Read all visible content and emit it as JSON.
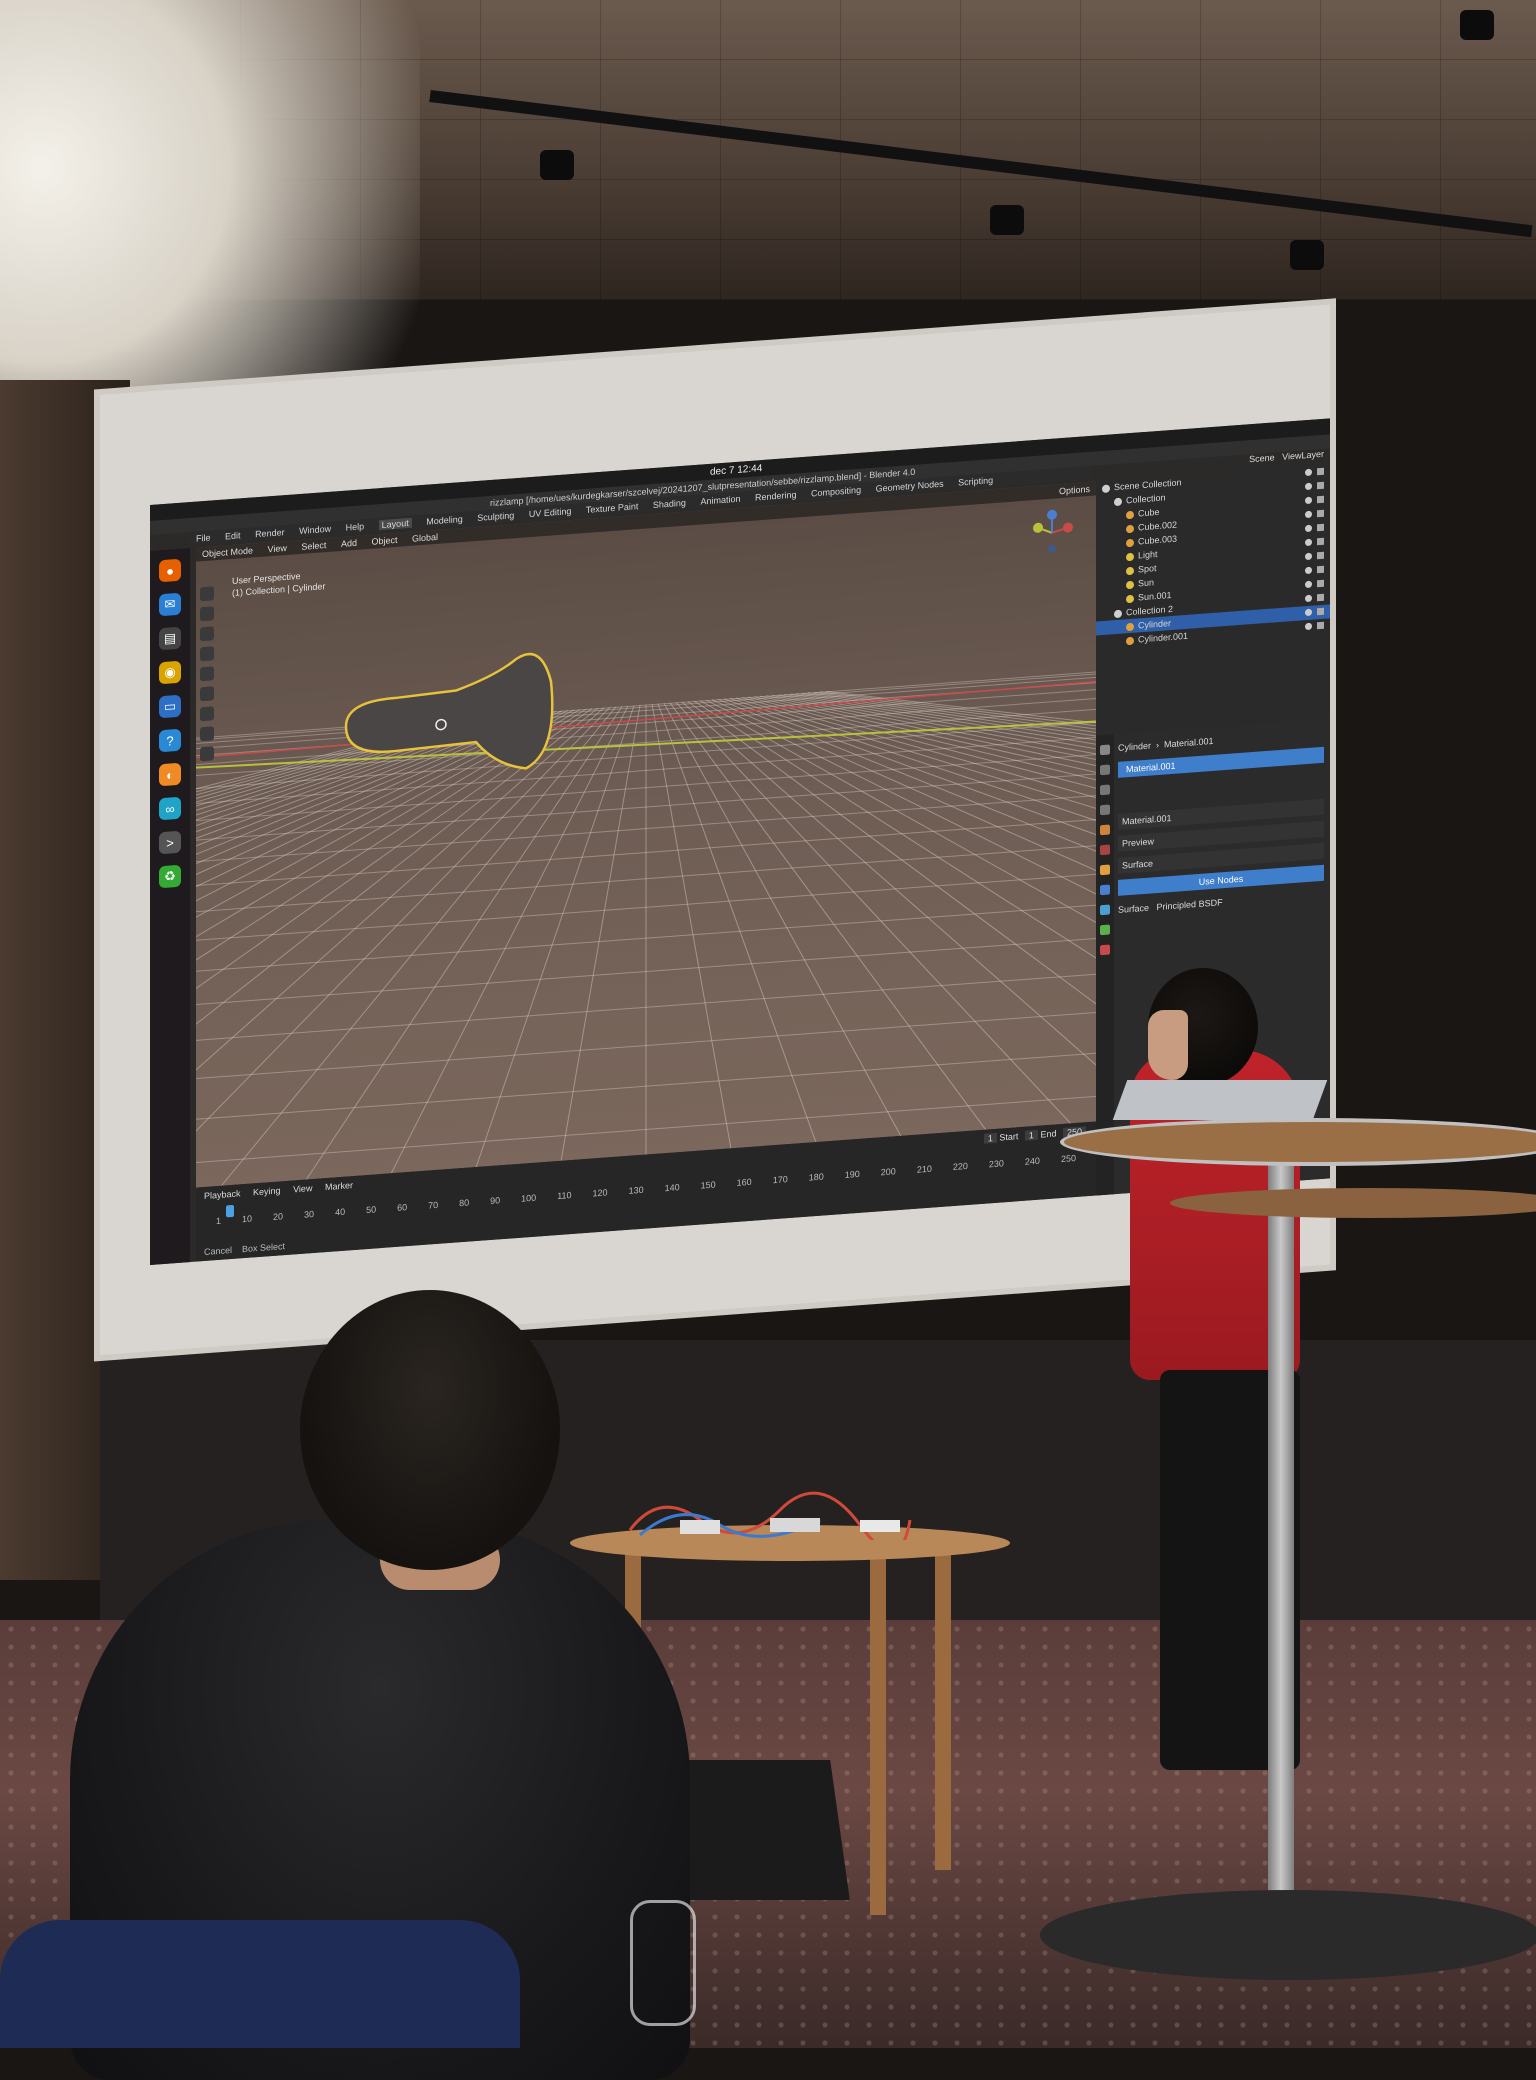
{
  "blender": {
    "clock": "dec 7 12:44",
    "window_title": "rizzlamp [/home/ues/kurdegkarser/szcelvej/20241207_slutpresentation/sebbe/rizzlamp.blend] - Blender 4.0",
    "menu": [
      "File",
      "Edit",
      "Render",
      "Window",
      "Help"
    ],
    "workspaces": [
      "Layout",
      "Modeling",
      "Sculpting",
      "UV Editing",
      "Texture Paint",
      "Shading",
      "Animation",
      "Rendering",
      "Compositing",
      "Geometry Nodes",
      "Scripting"
    ],
    "active_workspace": "Layout",
    "scene_label": "Scene",
    "view_layer_label": "ViewLayer",
    "viewport": {
      "header": [
        "Object Mode",
        "View",
        "Select",
        "Add",
        "Object"
      ],
      "transform": "Global",
      "info_line1": "User Perspective",
      "info_line2": "(1) Collection | Cylinder",
      "options": "Options"
    },
    "timeline": {
      "menus": [
        "Playback",
        "Keying",
        "View",
        "Marker"
      ],
      "current_frame": "1",
      "start_label": "Start",
      "start": "1",
      "end_label": "End",
      "end": "250",
      "frames": [
        "1",
        "10",
        "20",
        "30",
        "40",
        "50",
        "60",
        "70",
        "80",
        "90",
        "100",
        "110",
        "120",
        "130",
        "140",
        "150",
        "160",
        "170",
        "180",
        "190",
        "200",
        "210",
        "220",
        "230",
        "240",
        "250"
      ],
      "status": [
        "Cancel",
        "Box Select"
      ]
    },
    "outliner": {
      "rows": [
        {
          "label": "Scene Collection",
          "indent": 0,
          "selected": false,
          "color": "#cfcfcf"
        },
        {
          "label": "Collection",
          "indent": 1,
          "selected": false,
          "color": "#cfcfcf"
        },
        {
          "label": "Cube",
          "indent": 2,
          "selected": false,
          "color": "#e0a040"
        },
        {
          "label": "Cube.002",
          "indent": 2,
          "selected": false,
          "color": "#e0a040"
        },
        {
          "label": "Cube.003",
          "indent": 2,
          "selected": false,
          "color": "#e0a040"
        },
        {
          "label": "Light",
          "indent": 2,
          "selected": false,
          "color": "#e0c040"
        },
        {
          "label": "Spot",
          "indent": 2,
          "selected": false,
          "color": "#e0c040"
        },
        {
          "label": "Sun",
          "indent": 2,
          "selected": false,
          "color": "#e0c040"
        },
        {
          "label": "Sun.001",
          "indent": 2,
          "selected": false,
          "color": "#e0c040"
        },
        {
          "label": "Collection 2",
          "indent": 1,
          "selected": false,
          "color": "#cfcfcf"
        },
        {
          "label": "Cylinder",
          "indent": 2,
          "selected": true,
          "color": "#e0a040"
        },
        {
          "label": "Cylinder.001",
          "indent": 2,
          "selected": false,
          "color": "#e0a040"
        }
      ]
    },
    "properties": {
      "breadcrumb_object": "Cylinder",
      "breadcrumb_material": "Material.001",
      "material_slot": "Material.001",
      "material_field": "Material.001",
      "preview_label": "Preview",
      "surface_label": "Surface",
      "use_nodes_button": "Use Nodes",
      "surface_field_label": "Surface",
      "surface_shader": "Principled BSDF"
    },
    "colors": {
      "viewport_top": "#5a4c44",
      "selection_outline": "#e8c23a",
      "x_axis": "#c84a4a",
      "y_axis": "#b8c23a",
      "active_blue": "#3f7ecb"
    }
  }
}
